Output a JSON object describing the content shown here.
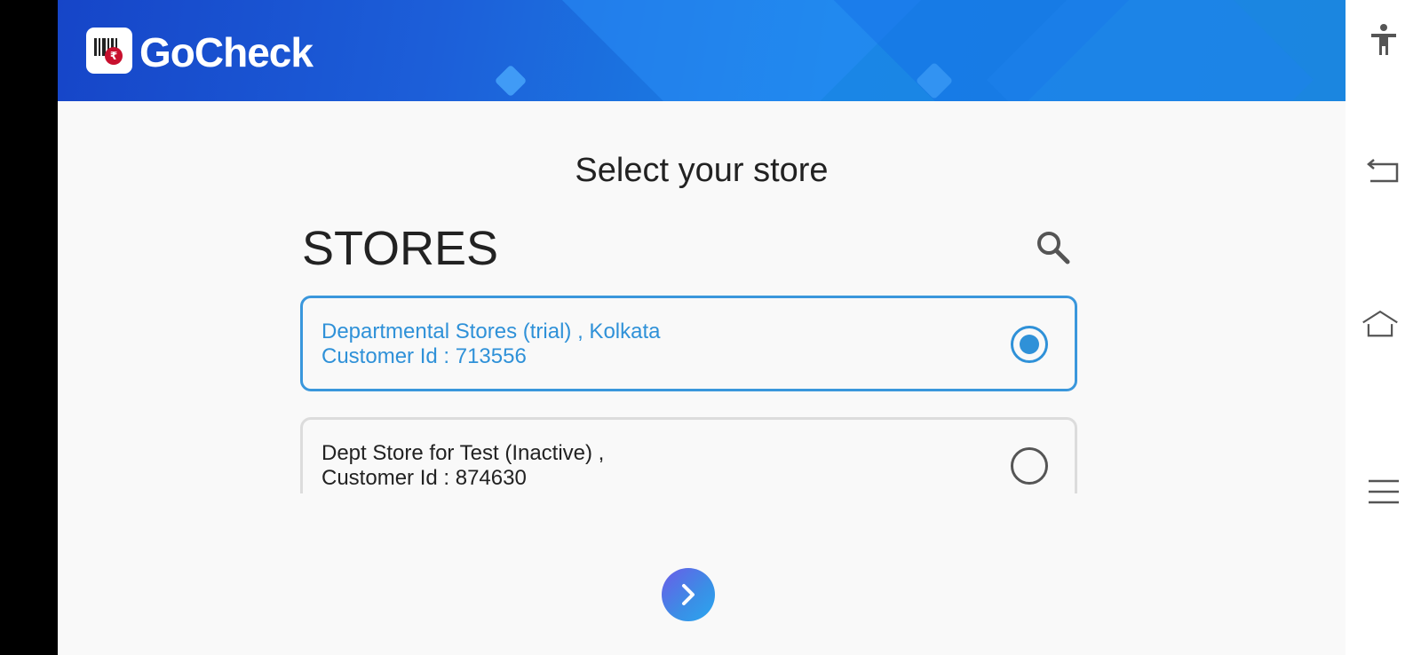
{
  "app": {
    "brand_name": "GoCheck",
    "logo_symbol": "₹"
  },
  "page": {
    "title": "Select your store",
    "section_heading": "STORES"
  },
  "stores": [
    {
      "name_line": "Departmental Stores (trial) , Kolkata",
      "customer_id_line": "Customer Id : 713556",
      "selected": true
    },
    {
      "name_line": "Dept Store for Test (Inactive) ,",
      "customer_id_line": "Customer Id : 874630",
      "selected": false
    }
  ],
  "icons": {
    "search": "search-icon",
    "next": "chevron-right-icon",
    "accessibility": "accessibility-icon",
    "back": "back-icon",
    "home": "home-icon",
    "menu": "menu-icon"
  },
  "colors": {
    "accent": "#2f91d8",
    "header": "#1a6fe0",
    "text": "#222222",
    "card_border": "#dcdcdc"
  }
}
